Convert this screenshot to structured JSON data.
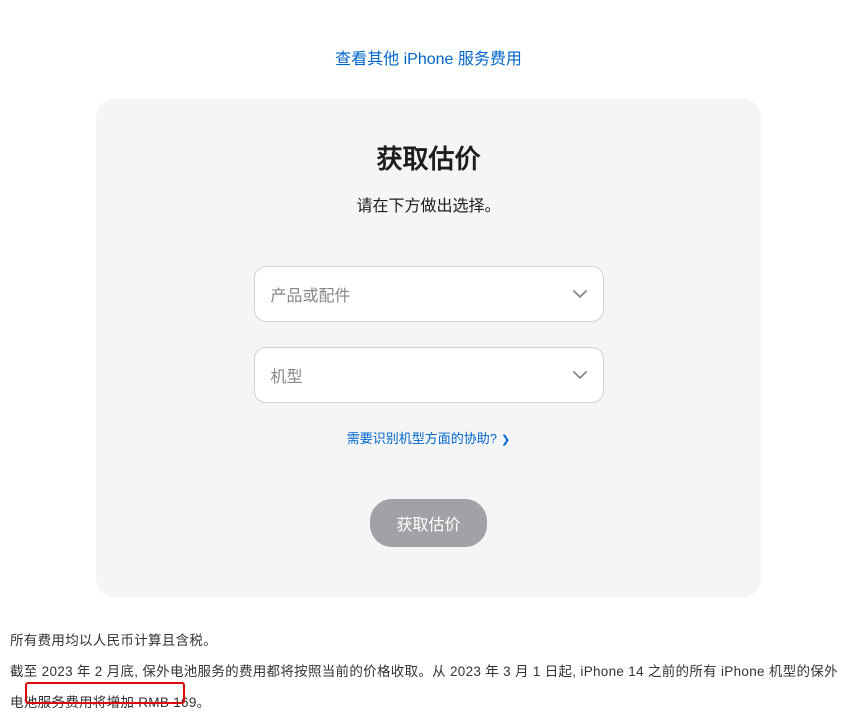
{
  "topLink": {
    "label": "查看其他 iPhone 服务费用"
  },
  "card": {
    "title": "获取估价",
    "subtitle": "请在下方做出选择。",
    "select1": {
      "placeholder": "产品或配件"
    },
    "select2": {
      "placeholder": "机型"
    },
    "helpLink": {
      "label": "需要识别机型方面的协助?"
    },
    "submitButton": {
      "label": "获取估价"
    }
  },
  "footer": {
    "line1": "所有费用均以人民币计算且含税。",
    "line2": "截至 2023 年 2 月底, 保外电池服务的费用都将按照当前的价格收取。从 2023 年 3 月 1 日起, iPhone 14 之前的所有 iPhone 机型的保外电池服务费用将增加 RMB 169。"
  }
}
